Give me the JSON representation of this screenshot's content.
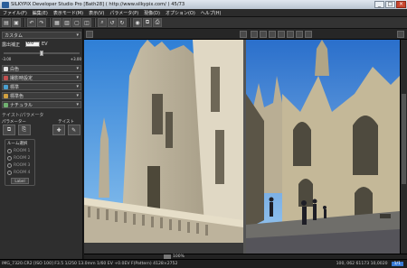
{
  "window": {
    "title": "SILKYPIX Developer Studio Pro [Bath28] ( http://www.silkypix.com/ )  45/73",
    "minimize_glyph": "_",
    "maximize_glyph": "□",
    "close_glyph": "×"
  },
  "menu": [
    "ファイル(F)",
    "編集(E)",
    "表示モード(M)",
    "表示(V)",
    "パラメータ(P)",
    "現像(D)",
    "オプション(O)",
    "ヘルプ(H)"
  ],
  "toolbar": {
    "buttons": [
      "open-icon",
      "save-icon",
      "undo-icon",
      "redo-icon",
      "thumb-icon",
      "grid-icon",
      "single-icon",
      "compare-icon",
      "zoom-icon",
      "rotate-left-icon",
      "rotate-right-icon",
      "develop-icon",
      "batch-icon",
      "print-icon"
    ]
  },
  "left_panel": {
    "preset_label": "カスタム",
    "exposure_label": "露出補正",
    "exposure_value": "0.0",
    "exposure_unit": "EV",
    "slider_min": "-3.00",
    "slider_max": "+3.00",
    "sections": [
      {
        "label": "白色",
        "icon_color": "#e0e0e0"
      },
      {
        "label": "撮影時設定",
        "icon_color": "#c05050"
      },
      {
        "label": "標準",
        "icon_color": "#4aa0d0"
      },
      {
        "label": "標準色",
        "icon_color": "#d0a040"
      },
      {
        "label": "ナチュラル",
        "icon_color": "#70b070"
      }
    ],
    "taste_label": "テイスト/パラメータ",
    "parameter_label": "パラメーター",
    "taste_sub_label": "テイスト",
    "room_list_label": "ルーム選択",
    "rooms": [
      "ROOM 1",
      "ROOM 2",
      "ROOM 3",
      "ROOM 4"
    ],
    "room_action_label": "Label"
  },
  "viewer": {
    "zoom_left": "100",
    "zoom_unit": "%"
  },
  "status_bar": {
    "text": "IMG_7320.CR2  [ISO 100]  F3.5  1/250  13.0mm  1/60 EV  +0.0EV  F(Pattern)  4128×2752",
    "right_values": "100, 062  61173  10,0020",
    "progress": "1/1"
  }
}
